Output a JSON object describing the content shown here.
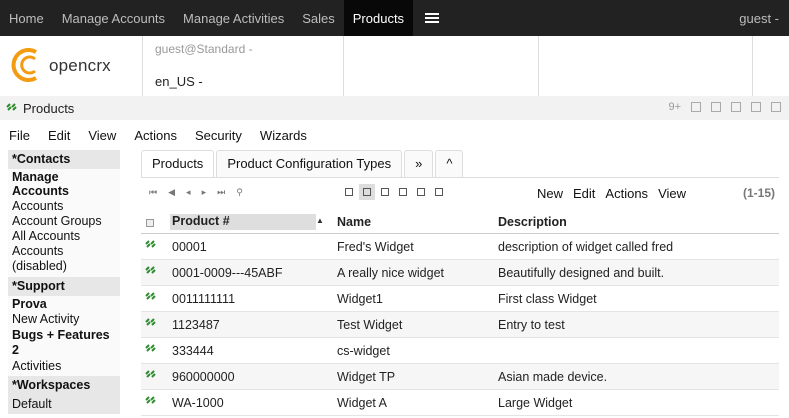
{
  "topnav": {
    "items": [
      "Home",
      "Manage Accounts",
      "Manage Activities",
      "Sales",
      "Products"
    ],
    "active_index": 4,
    "user_label": "guest -"
  },
  "header": {
    "logo_text": "opencrx",
    "user_role": "guest@Standard -",
    "locale": "en_US -"
  },
  "titlebar": {
    "title": "Products",
    "count": "9+"
  },
  "menubar": [
    "File",
    "Edit",
    "View",
    "Actions",
    "Security",
    "Wizards"
  ],
  "sidebar": {
    "contacts_header": "*Contacts",
    "manage_accounts": "Manage Accounts",
    "links1": [
      "Accounts",
      "Account Groups",
      "All Accounts",
      "Accounts (disabled)"
    ],
    "support_header": "*Support",
    "prova": "Prova",
    "new_activity": "New Activity",
    "bugs": "Bugs + Features 2",
    "activities": "Activities",
    "workspaces_header": "*Workspaces",
    "default": "Default"
  },
  "tabs": [
    "Products",
    "Product Configuration Types",
    "»",
    "^"
  ],
  "grid_actions": [
    "New",
    "Edit",
    "Actions",
    "View"
  ],
  "grid_count": "(1-15)",
  "table": {
    "headers": {
      "number": "Product #",
      "name": "Name",
      "description": "Description"
    },
    "rows": [
      {
        "number": "00001",
        "name": "Fred's Widget",
        "description": "description of widget called fred"
      },
      {
        "number": "0001-0009---45ABF",
        "name": "A really nice widget",
        "description": "Beautifully designed and built."
      },
      {
        "number": "0011111111",
        "name": "Widget1",
        "description": "First class Widget"
      },
      {
        "number": "1123487",
        "name": "Test Widget",
        "description": "Entry to test"
      },
      {
        "number": "333444",
        "name": "cs-widget",
        "description": ""
      },
      {
        "number": "960000000",
        "name": "Widget TP",
        "description": "Asian made device."
      },
      {
        "number": "WA-1000",
        "name": "Widget A",
        "description": "Large Widget"
      }
    ]
  },
  "colors": {
    "nav_bg": "#222222",
    "logo_orange": "#f39c12",
    "row_icon_green": "#2e8b2e"
  }
}
